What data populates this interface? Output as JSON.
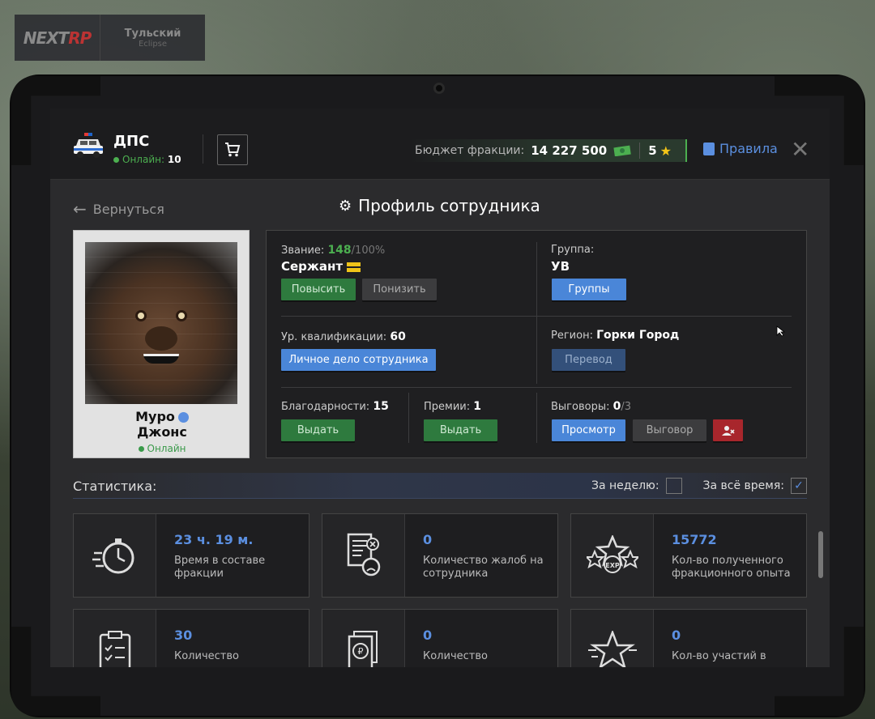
{
  "logo": {
    "brand_a": "NEXT",
    "brand_b": "RP",
    "server": "Тульский",
    "server_sub": "Eclipse"
  },
  "header": {
    "faction": "ДПС",
    "online_label": "Онлайн:",
    "online_count": "10",
    "budget_label": "Бюджет фракции:",
    "budget_value": "14 227 500",
    "rating": "5",
    "rules_label": "Правила",
    "close": "✕"
  },
  "nav": {
    "back_label": "Вернуться",
    "page_title": "Профиль сотрудника"
  },
  "employee": {
    "name_line1": "Муро",
    "name_line2": "Джонс",
    "status": "Онлайн"
  },
  "rank": {
    "label": "Звание:",
    "progress": "148",
    "progress_max": "/100%",
    "name": "Сержант",
    "promote": "Повысить",
    "demote": "Понизить"
  },
  "group": {
    "label": "Группа:",
    "value": "УВ",
    "button": "Группы"
  },
  "qualification": {
    "label": "Ур. квалификации:",
    "value": "60",
    "button": "Личное дело сотрудника"
  },
  "region": {
    "label": "Регион:",
    "value": "Горки Город",
    "button": "Перевод"
  },
  "thanks": {
    "label": "Благодарности:",
    "value": "15",
    "button": "Выдать"
  },
  "bonus": {
    "label": "Премии:",
    "value": "1",
    "button": "Выдать"
  },
  "reprimands": {
    "label": "Выговоры:",
    "value": "0",
    "max": "/3",
    "view": "Просмотр",
    "give": "Выговор"
  },
  "stats": {
    "title": "Статистика:",
    "week_label": "За неделю:",
    "all_label": "За всё время:",
    "week_checked": false,
    "all_checked": true,
    "cards": [
      {
        "value": "23 ч. 19 м.",
        "desc": "Время в составе фракции",
        "icon": "stopwatch-icon"
      },
      {
        "value": "0",
        "desc": "Количество жалоб на сотрудника",
        "icon": "complaint-icon"
      },
      {
        "value": "15772",
        "desc": "Кол-во полученного фракционного опыта",
        "icon": "exp-icon"
      },
      {
        "value": "30",
        "desc": "Количество",
        "icon": "clipboard-icon"
      },
      {
        "value": "0",
        "desc": "Количество",
        "icon": "ruble-doc-icon"
      },
      {
        "value": "0",
        "desc": "Кол-во участий в",
        "icon": "star-icon"
      }
    ]
  },
  "colors": {
    "accent": "#5b8fe0",
    "green": "#2e7a3e",
    "online": "#4caf50",
    "red": "#a8262c"
  }
}
